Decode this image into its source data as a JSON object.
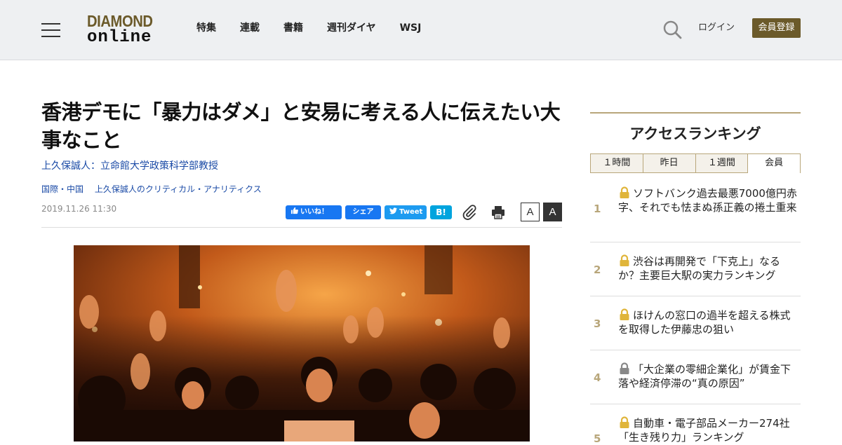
{
  "header": {
    "logo_line1": "DIAMOND",
    "logo_line2": "online",
    "nav": [
      "特集",
      "連載",
      "書籍",
      "週刊ダイヤ",
      "WSJ"
    ],
    "login": "ログイン",
    "register": "会員登録"
  },
  "article": {
    "title": "香港デモに「暴力はダメ」と安易に考える人に伝えたい大事なこと",
    "author": "上久保誠人：立命館大学政策科学部教授",
    "tag1": "国際・中国",
    "tag2": "上久保誠人のクリティカル・アナリティクス",
    "date": "2019.11.26 11:30"
  },
  "share": {
    "like": "いいね！",
    "fb_share": "シェア",
    "tweet": "Tweet",
    "hatena": "B!",
    "font_small": "A",
    "font_large": "A"
  },
  "ranking": {
    "title": "アクセスランキング",
    "tabs": [
      "１時間",
      "昨日",
      "１週間",
      "会員"
    ],
    "items": [
      {
        "rank": "1",
        "title": "ソフトバンク過去最悪7000億円赤字、それでも怯まぬ孫正義の捲土重来"
      },
      {
        "rank": "2",
        "title": "渋谷は再開発で「下克上」なるか？主要巨大駅の実力ランキング"
      },
      {
        "rank": "3",
        "title": "ほけんの窓口の過半を超える株式を取得した伊藤忠の狙い"
      },
      {
        "rank": "4",
        "title": "「大企業の零細企業化」が賃金下落や経済停滞の“真の原因”"
      },
      {
        "rank": "5",
        "title": "自動車・電子部品メーカー274社「生き残り力」ランキング"
      }
    ]
  },
  "colors": {
    "brand_gold": "#6b5a2a",
    "rank_gold": "#b8a67a",
    "link_blue": "#1a4aa6",
    "lock_gold": "#e0b53a",
    "lock_gray": "#888888"
  }
}
